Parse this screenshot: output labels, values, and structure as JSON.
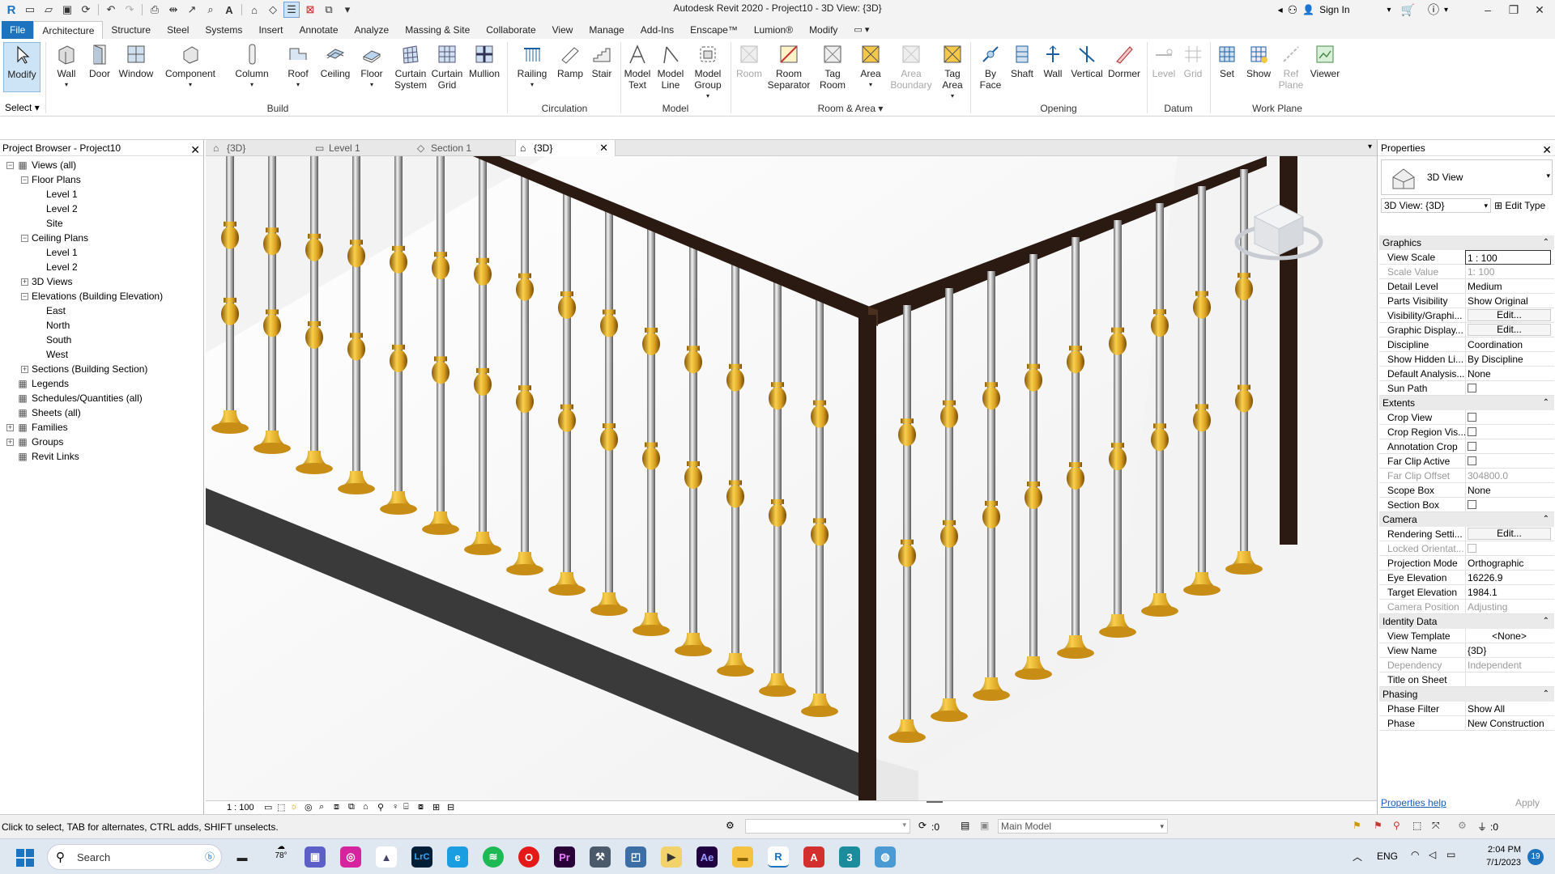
{
  "window": {
    "title": "Autodesk Revit 2020 - Project10 - 3D View: {3D}",
    "sign_in": "Sign In"
  },
  "menu": {
    "tabs": [
      "File",
      "Architecture",
      "Structure",
      "Steel",
      "Systems",
      "Insert",
      "Annotate",
      "Analyze",
      "Massing & Site",
      "Collaborate",
      "View",
      "Manage",
      "Add-Ins",
      "Enscape™",
      "Lumion®",
      "Modify"
    ],
    "active": "Architecture"
  },
  "ribbon": {
    "modify": "Modify",
    "select": "Select",
    "build": {
      "label": "Build",
      "wall": "Wall",
      "door": "Door",
      "window": "Window",
      "component": "Component",
      "column": "Column",
      "roof": "Roof",
      "ceiling": "Ceiling",
      "floor": "Floor",
      "curtain_system": "Curtain System",
      "curtain_grid": "Curtain Grid",
      "mullion": "Mullion"
    },
    "circulation": {
      "label": "Circulation",
      "railing": "Railing",
      "ramp": "Ramp",
      "stair": "Stair"
    },
    "model": {
      "label": "Model",
      "model_text": "Model Text",
      "model_line": "Model Line",
      "model_group": "Model Group"
    },
    "room_area": {
      "label": "Room & Area",
      "room": "Room",
      "room_separator": "Room Separator",
      "tag_room": "Tag Room",
      "area": "Area",
      "area_boundary": "Area Boundary",
      "tag_area": "Tag Area"
    },
    "opening": {
      "label": "Opening",
      "by_face": "By Face",
      "shaft": "Shaft",
      "wall": "Wall",
      "vertical": "Vertical",
      "dormer": "Dormer"
    },
    "datum": {
      "label": "Datum",
      "level": "Level",
      "grid": "Grid"
    },
    "work_plane": {
      "label": "Work Plane",
      "set": "Set",
      "show": "Show",
      "ref_plane": "Ref Plane",
      "viewer": "Viewer"
    }
  },
  "project_browser": {
    "title": "Project Browser - Project10",
    "items": [
      {
        "label": "Views (all)",
        "level": 0,
        "toggle": "−"
      },
      {
        "label": "Floor Plans",
        "level": 1,
        "toggle": "−"
      },
      {
        "label": "Level 1",
        "level": 2
      },
      {
        "label": "Level 2",
        "level": 2
      },
      {
        "label": "Site",
        "level": 2
      },
      {
        "label": "Ceiling Plans",
        "level": 1,
        "toggle": "−"
      },
      {
        "label": "Level 1",
        "level": 2
      },
      {
        "label": "Level 2",
        "level": 2
      },
      {
        "label": "3D Views",
        "level": 1,
        "toggle": "+"
      },
      {
        "label": "Elevations (Building Elevation)",
        "level": 1,
        "toggle": "−"
      },
      {
        "label": "East",
        "level": 2
      },
      {
        "label": "North",
        "level": 2
      },
      {
        "label": "South",
        "level": 2
      },
      {
        "label": "West",
        "level": 2
      },
      {
        "label": "Sections (Building Section)",
        "level": 1,
        "toggle": "+"
      },
      {
        "label": "Legends",
        "level": 0
      },
      {
        "label": "Schedules/Quantities (all)",
        "level": 0
      },
      {
        "label": "Sheets (all)",
        "level": 0
      },
      {
        "label": "Families",
        "level": 0,
        "toggle": "+"
      },
      {
        "label": "Groups",
        "level": 0,
        "toggle": "+"
      },
      {
        "label": "Revit Links",
        "level": 0
      }
    ]
  },
  "view_tabs": [
    "{3D}",
    "Level 1",
    "Section 1",
    "{3D}"
  ],
  "view_control": {
    "scale": "1 : 100"
  },
  "properties": {
    "title": "Properties",
    "type": "3D View",
    "selector": "3D View: {3D}",
    "edit_type": "Edit Type",
    "sections": [
      {
        "name": "Graphics",
        "rows": [
          {
            "n": "View Scale",
            "v": "1 : 100"
          },
          {
            "n": "Scale Value",
            "v": "1: 100",
            "dis": true
          },
          {
            "n": "Detail Level",
            "v": "Medium"
          },
          {
            "n": "Parts Visibility",
            "v": "Show Original"
          },
          {
            "n": "Visibility/Graphi...",
            "v": "Edit...",
            "btn": true
          },
          {
            "n": "Graphic Display...",
            "v": "Edit...",
            "btn": true
          },
          {
            "n": "Discipline",
            "v": "Coordination"
          },
          {
            "n": "Show Hidden Li...",
            "v": "By Discipline"
          },
          {
            "n": "Default Analysis...",
            "v": "None"
          },
          {
            "n": "Sun Path",
            "v": "",
            "cb": true
          }
        ]
      },
      {
        "name": "Extents",
        "rows": [
          {
            "n": "Crop View",
            "v": "",
            "cb": true
          },
          {
            "n": "Crop Region Vis...",
            "v": "",
            "cb": true
          },
          {
            "n": "Annotation Crop",
            "v": "",
            "cb": true
          },
          {
            "n": "Far Clip Active",
            "v": "",
            "cb": true
          },
          {
            "n": "Far Clip Offset",
            "v": "304800.0",
            "dis": true
          },
          {
            "n": "Scope Box",
            "v": "None"
          },
          {
            "n": "Section Box",
            "v": "",
            "cb": true
          }
        ]
      },
      {
        "name": "Camera",
        "rows": [
          {
            "n": "Rendering Setti...",
            "v": "Edit...",
            "btn": true
          },
          {
            "n": "Locked Orientat...",
            "v": "",
            "cb": true,
            "dis": true
          },
          {
            "n": "Projection Mode",
            "v": "Orthographic"
          },
          {
            "n": "Eye Elevation",
            "v": "16226.9"
          },
          {
            "n": "Target Elevation",
            "v": "1984.1"
          },
          {
            "n": "Camera Position",
            "v": "Adjusting",
            "dis": true
          }
        ]
      },
      {
        "name": "Identity Data",
        "rows": [
          {
            "n": "View Template",
            "v": "<None>",
            "center": true
          },
          {
            "n": "View Name",
            "v": "{3D}"
          },
          {
            "n": "Dependency",
            "v": "Independent",
            "dis": true
          },
          {
            "n": "Title on Sheet",
            "v": ""
          }
        ]
      },
      {
        "name": "Phasing",
        "rows": [
          {
            "n": "Phase Filter",
            "v": "Show All"
          },
          {
            "n": "Phase",
            "v": "New Construction"
          }
        ]
      }
    ],
    "help": "Properties help",
    "apply": "Apply"
  },
  "status": {
    "text": "Click to select, TAB for alternates, CTRL adds, SHIFT unselects.",
    "workset_count": ":0",
    "model": "Main Model",
    "filter_count": ":0"
  },
  "taskbar": {
    "search": "Search",
    "weather": "78°",
    "lang": "ENG",
    "time": "2:04 PM",
    "date": "7/1/2023",
    "badge": "19"
  },
  "colors": {
    "accent": "#1e73be",
    "rail": "#2a1a12",
    "brass": "#d8a020",
    "slab": "#3a3a3a"
  }
}
